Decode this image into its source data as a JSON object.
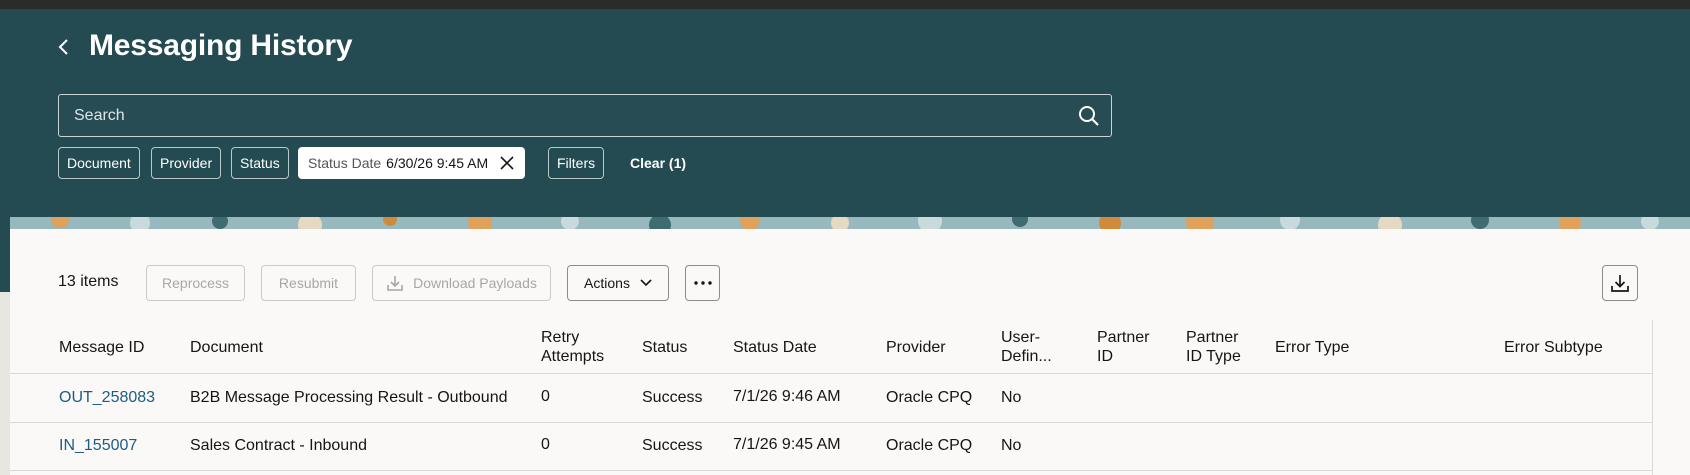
{
  "page": {
    "title": "Messaging History"
  },
  "search": {
    "placeholder": "Search"
  },
  "filters": {
    "chips": [
      "Document",
      "Provider",
      "Status"
    ],
    "active_chip": {
      "key": "Status Date",
      "value": "6/30/26 9:45 AM"
    },
    "filters_label": "Filters",
    "clear_label": "Clear (1)"
  },
  "toolbar": {
    "count": "13 items",
    "reprocess": "Reprocess",
    "resubmit": "Resubmit",
    "download_payloads": "Download Payloads",
    "actions": "Actions"
  },
  "table": {
    "columns": {
      "message_id": "Message ID",
      "document": "Document",
      "retry_1": "Retry",
      "retry_2": "Attempts",
      "status": "Status",
      "status_date": "Status Date",
      "provider": "Provider",
      "user_1": "User-",
      "user_2": "Defin...",
      "partner_1": "Partner",
      "partner_2": "ID",
      "ptype_1": "Partner",
      "ptype_2": "ID Type",
      "error_type": "Error Type",
      "error_subtype": "Error Subtype"
    },
    "rows": [
      {
        "message_id": "OUT_258083",
        "document": "B2B Message Processing Result - Outbound",
        "retry": "0",
        "status": "Success",
        "status_date": "7/1/26 9:46 AM",
        "provider": "Oracle CPQ",
        "user_defined": "No"
      },
      {
        "message_id": "IN_155007",
        "document": "Sales Contract - Inbound",
        "retry": "0",
        "status": "Success",
        "status_date": "7/1/26 9:45 AM",
        "provider": "Oracle CPQ",
        "user_defined": "No"
      }
    ]
  },
  "colors": {
    "header_bg": "#244a52",
    "link": "#1b5d83",
    "panel_bg": "#fbf9f8"
  }
}
